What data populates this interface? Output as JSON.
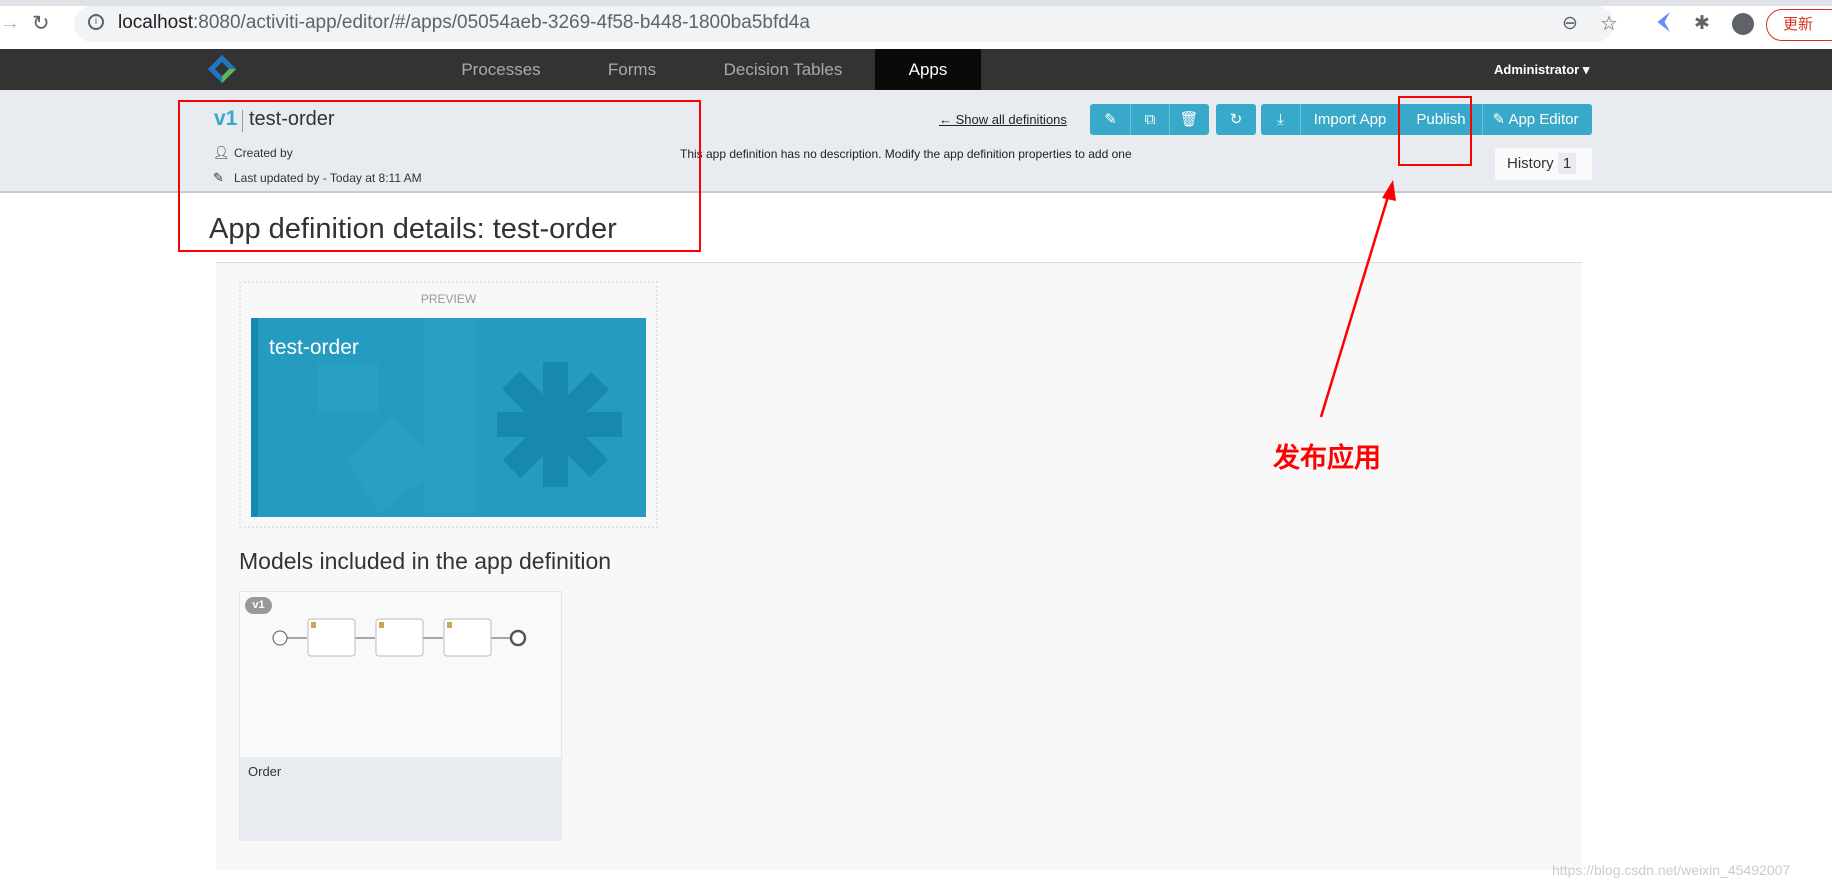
{
  "browser": {
    "url_host": "localhost",
    "url_rest": ":8080/activiti-app/editor/#/apps/05054aeb-3269-4f58-b448-1800ba5bfd4a",
    "update_label": "更新"
  },
  "nav": {
    "tabs": [
      {
        "label": "Processes"
      },
      {
        "label": "Forms"
      },
      {
        "label": "Decision Tables"
      },
      {
        "label": "Apps",
        "active": true
      }
    ],
    "user": "Administrator"
  },
  "header": {
    "version": "v1",
    "name": "test-order",
    "created_by": "Created by",
    "last_updated": "Last updated by - Today at 8:11 AM",
    "description": "This app definition has no description. Modify the app definition properties to add one",
    "show_all": "← Show all definitions",
    "import_label": "Import App",
    "publish_label": "Publish",
    "app_editor_label": "App Editor",
    "history_label": "History",
    "history_count": "1"
  },
  "main": {
    "title": "App definition details: test-order",
    "preview_label": "PREVIEW",
    "tile_name": "test-order",
    "models_heading": "Models included in the app definition",
    "models": [
      {
        "name": "Order",
        "version": "v1"
      }
    ]
  },
  "annotation": {
    "text": "发布应用",
    "color": "#ff0000"
  },
  "watermark": "https://blog.csdn.net/weixin_45492007",
  "colors": {
    "accent": "#38a9c9",
    "navbar": "#333333",
    "tile": "#259bbf"
  }
}
